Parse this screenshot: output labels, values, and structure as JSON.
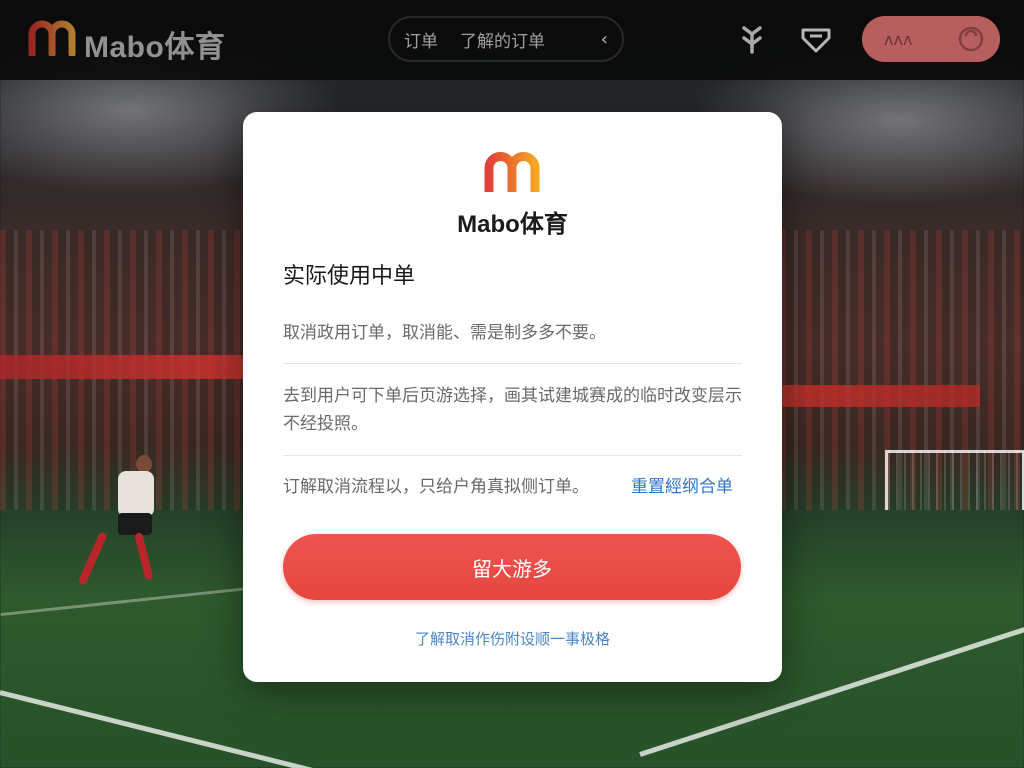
{
  "header": {
    "brand": "Mabo体育",
    "nav_tab_1": "订单",
    "nav_tab_2": "了解的订单",
    "nav_chevron": "‹",
    "login_label": "ᴧᴧᴧ",
    "icons": [
      "logo-m-icon",
      "chevron-left-icon",
      "gift-icon",
      "shield-icon",
      "user-icon"
    ]
  },
  "modal": {
    "brand": "Mabo体育",
    "title": "实际使用中单",
    "paragraph_1": "取消政用订单，取消能、需是制多多不要。",
    "paragraph_2": "去到用户可下单后页游选择，画其试建城赛成的临时改变层示不经投照。",
    "paragraph_3": "订解取消流程以，只给户角真拟侧订单。",
    "link_right": "重置經纲合单",
    "primary_button": "留大游多",
    "footer_link": "了解取消作伤附设顺一事极格"
  },
  "colors": {
    "accent_red": "#e84b45",
    "link_blue": "#2f76c8",
    "logo_red": "#e4453c",
    "logo_orange": "#f5a623"
  }
}
